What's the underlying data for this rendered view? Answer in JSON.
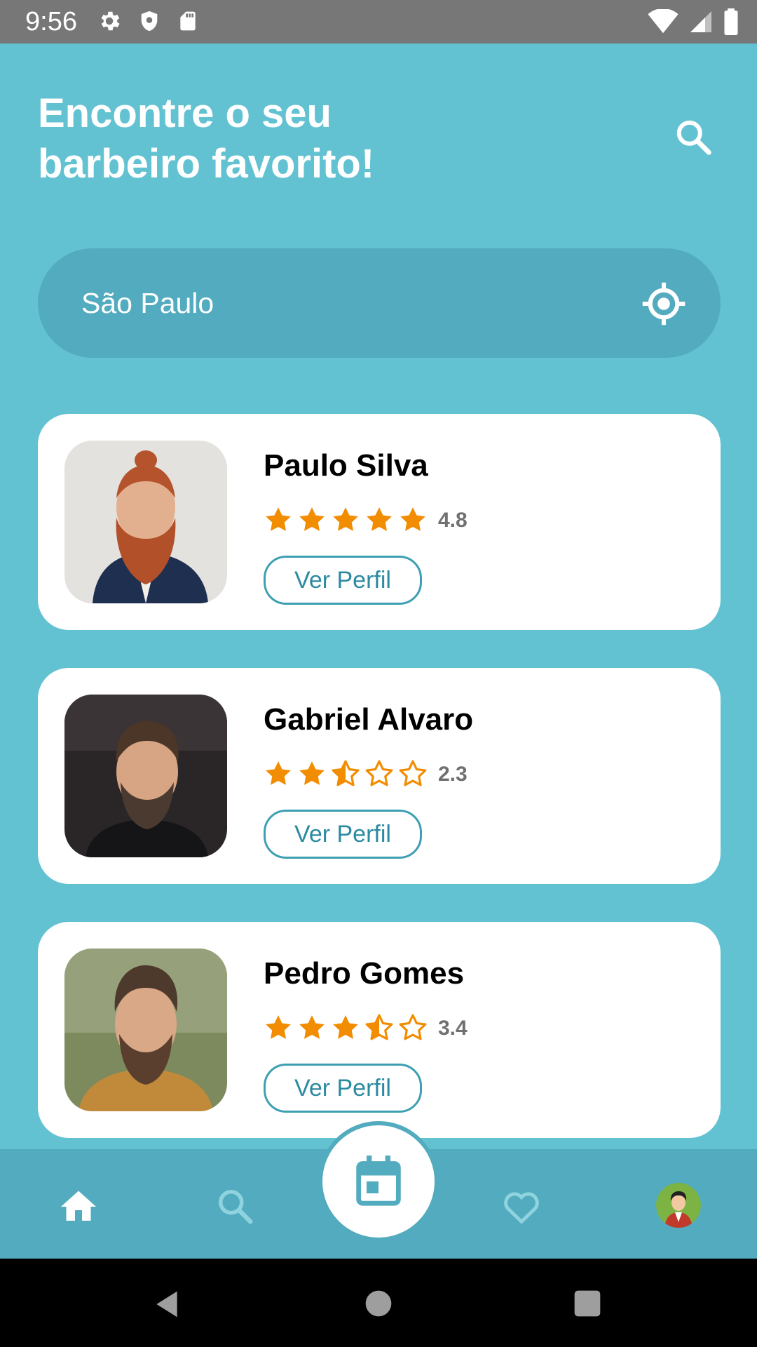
{
  "status_bar": {
    "time": "9:56"
  },
  "header": {
    "title_line1": "Encontre o seu",
    "title_line2": "barbeiro favorito!"
  },
  "location": {
    "value": "São Paulo"
  },
  "barbers": [
    {
      "name": "Paulo Silva",
      "rating": "4.8",
      "rating_value": 4.8,
      "button": "Ver Perfil"
    },
    {
      "name": "Gabriel Alvaro",
      "rating": "2.3",
      "rating_value": 2.3,
      "button": "Ver Perfil"
    },
    {
      "name": "Pedro Gomes",
      "rating": "3.4",
      "rating_value": 3.4,
      "button": "Ver Perfil"
    }
  ],
  "bottom_nav": {
    "items": [
      "home-icon",
      "search-icon",
      "calendar-icon",
      "heart-icon",
      "profile-avatar"
    ],
    "active": "home-icon"
  },
  "colors": {
    "primary": "#63c2d2",
    "primary_dark": "#52abbe",
    "star": "#f28c00"
  }
}
